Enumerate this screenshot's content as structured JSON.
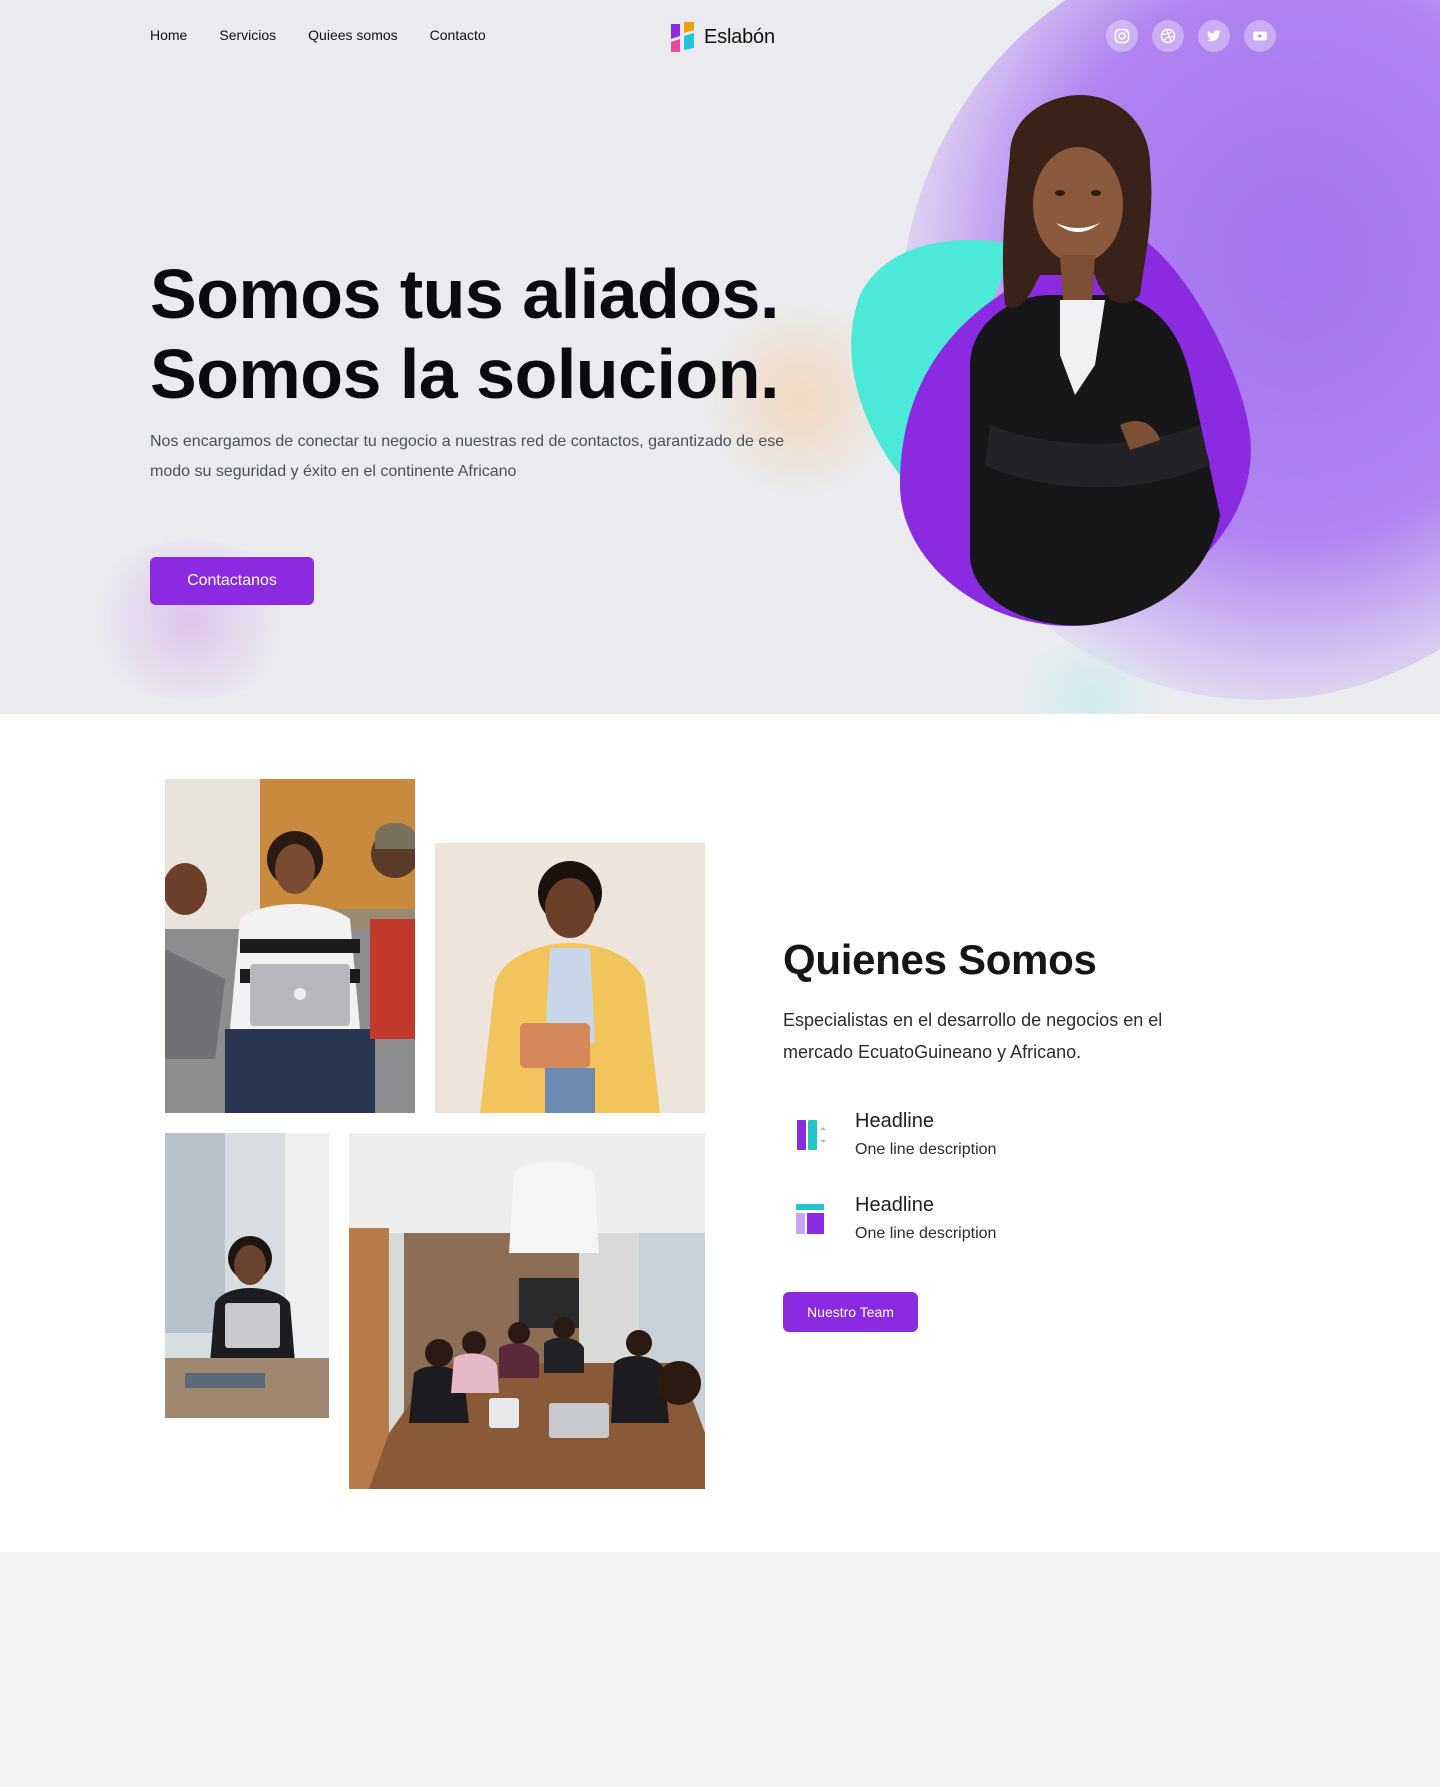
{
  "nav": {
    "items": [
      {
        "label": "Home"
      },
      {
        "label": "Servicios"
      },
      {
        "label": "Quiees somos"
      },
      {
        "label": "Contacto"
      }
    ],
    "logo_text": "Eslabón",
    "socials": [
      "instagram-icon",
      "dribbble-icon",
      "twitter-icon",
      "youtube-icon"
    ]
  },
  "hero": {
    "title_line1": "Somos tus aliados.",
    "title_line2": "Somos la solucion.",
    "description": "Nos encargamos de conectar tu negocio a nuestras red de contactos, garantizado de ese modo su seguridad y éxito en el continente Africano",
    "cta_label": "Contactanos"
  },
  "about": {
    "title": "Quienes Somos",
    "description": "Especialistas en el desarrollo de negocios en el mercado EcuatoGuineano y Africano.",
    "features": [
      {
        "headline": "Headline",
        "description": "One line description",
        "icon": "columns-icon"
      },
      {
        "headline": "Headline",
        "description": "One line description",
        "icon": "layout-icon"
      }
    ],
    "cta_label": "Nuestro Team"
  },
  "colors": {
    "primary": "#8a2be2",
    "accent_teal": "#4ce8d8",
    "hero_bg": "#e9ebee"
  }
}
